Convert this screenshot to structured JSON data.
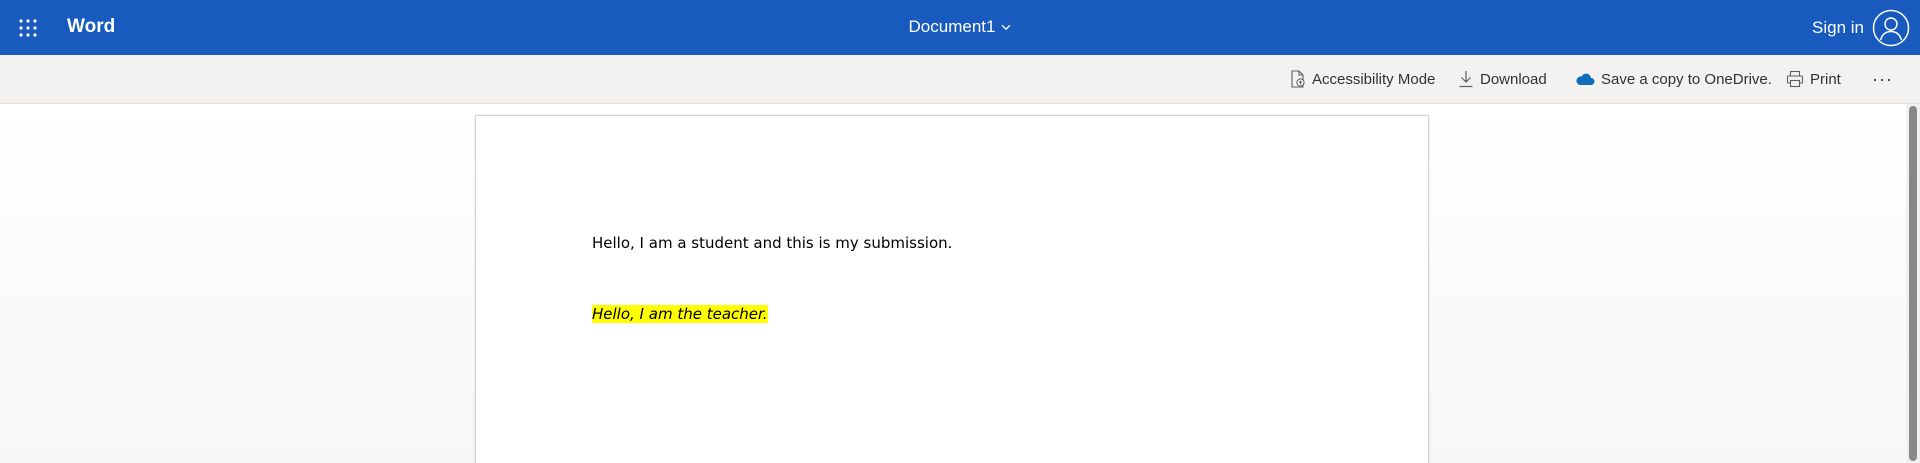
{
  "header": {
    "app_name": "Word",
    "document_title": "Document1",
    "sign_in_label": "Sign in",
    "background_color": "#185abd"
  },
  "toolbar": {
    "accessibility_label": "Accessibility Mode",
    "download_label": "Download",
    "save_copy_label": "Save a copy to OneDrive.",
    "print_label": "Print",
    "more_label": "···",
    "background_color": "#f3f2f1"
  },
  "document": {
    "paragraphs": [
      "Hello, I am a student and this is my submission.",
      "Hello, I am the teacher."
    ],
    "highlight_color": "#ffff00"
  },
  "icons": {
    "app_launcher": "waffle-icon",
    "title_menu": "chevron-down-icon",
    "account": "person-icon",
    "accessibility": "accessibility-document-icon",
    "download": "download-icon",
    "onedrive": "cloud-icon",
    "print": "printer-icon",
    "more": "ellipsis-icon"
  }
}
